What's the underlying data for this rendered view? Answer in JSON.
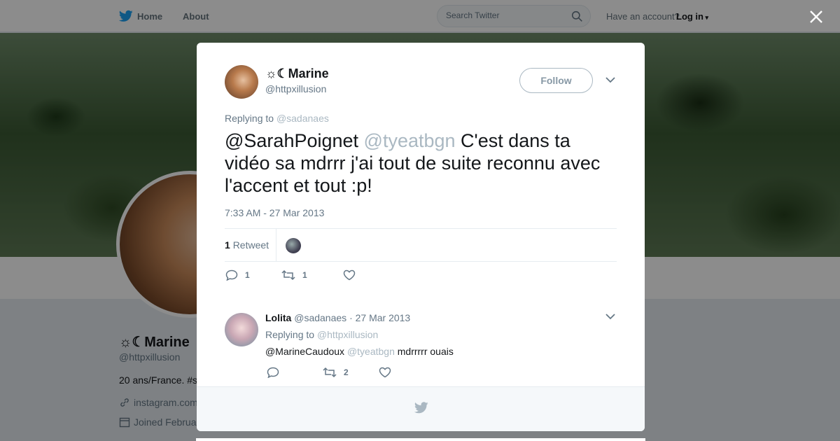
{
  "nav": {
    "home_label": "Home",
    "about_label": "About",
    "search_placeholder": "Search Twitter",
    "have_account": "Have an account?",
    "login_label": "Log in"
  },
  "profile": {
    "name": "☼☾Marine",
    "handle": "@httpxillusion",
    "bio": "20 ans/France. #s",
    "link": "instagram.com",
    "joined": "Joined Februa"
  },
  "tweet": {
    "author_name": "☼☾Marine",
    "author_handle": "@httpxillusion",
    "follow_label": "Follow",
    "replying_prefix": "Replying to",
    "replying_to": "@sadanaes",
    "text_mention1": "@SarahPoignet",
    "text_mention2": "@tyeatbgn",
    "text_body": " C'est dans ta vidéo sa mdrrr j'ai tout de suite reconnu avec l'accent et tout :p!",
    "timestamp": "7:33 AM - 27 Mar 2013",
    "retweet_count": "1",
    "retweet_label": "Retweet",
    "reply_count": "1",
    "rt_count": "1"
  },
  "reply": {
    "name": "Lolita",
    "handle": "@sadanaes",
    "date": "· 27 Mar 2013",
    "replying_prefix": "Replying to",
    "replying_to": "@httpxillusion",
    "text_mention1": "@MarineCaudoux",
    "text_mention2": "@tyeatbgn",
    "text_body": " mdrrrrr ouais",
    "rt_count": "2"
  },
  "colors": {
    "twitter_blue": "#1da1f2",
    "secondary_text": "#657786",
    "mention_grey": "#aab8c2"
  }
}
